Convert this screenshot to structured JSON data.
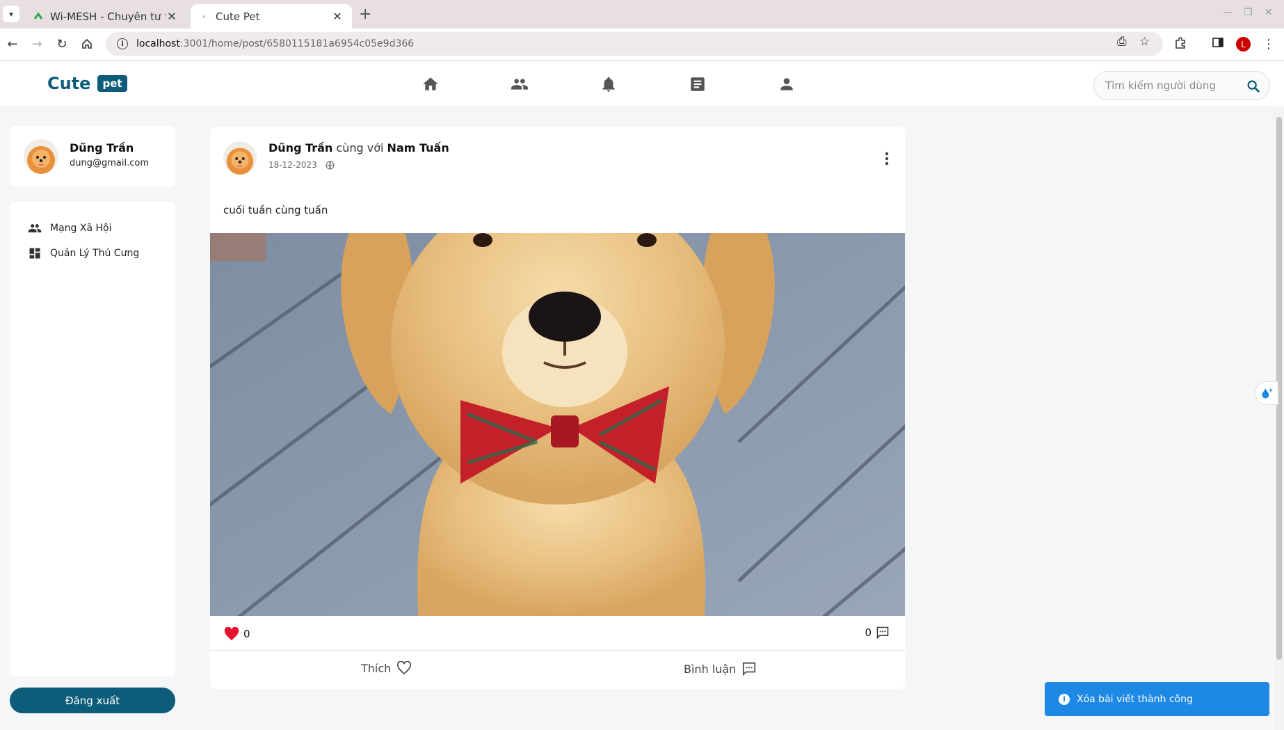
{
  "browser": {
    "tabs": [
      {
        "title": "Wi-MESH - Chuyên tư vấn",
        "active": false
      },
      {
        "title": "Cute Pet",
        "active": true
      }
    ],
    "url_host": "localhost",
    "url_path": ":3001/home/post/6580115181a6954c05e9d366",
    "profile_initial": "L"
  },
  "header": {
    "logo_text": "Cute",
    "logo_badge": "pet",
    "nav_icons": [
      "home-icon",
      "friends-icon",
      "notifications-icon",
      "posts-icon",
      "profile-icon"
    ],
    "search_placeholder": "Tìm kiếm người dùng"
  },
  "sidebar": {
    "user_name": "Dũng Trần",
    "user_email": "dung@gmail.com",
    "menu": [
      {
        "label": "Mạng Xã Hội",
        "icon": "people-icon"
      },
      {
        "label": "Quản Lý Thú Cưng",
        "icon": "dashboard-icon"
      }
    ],
    "logout_label": "Đăng xuất"
  },
  "post": {
    "author": "Dũng Trần",
    "with_text": "cùng với",
    "tagged": "Nam Tuấn",
    "date": "18-12-2023",
    "privacy_icon": "globe-icon",
    "content": "cuối tuần cùng tuấn",
    "like_count": "0",
    "comment_count": "0",
    "like_label": "Thích",
    "comment_label": "Bình luận"
  },
  "toast": {
    "message": "Xóa bài viết thành công",
    "color": "#1e88e5"
  },
  "colors": {
    "brand": "#0d5c7a",
    "like_heart": "#e8132f"
  }
}
